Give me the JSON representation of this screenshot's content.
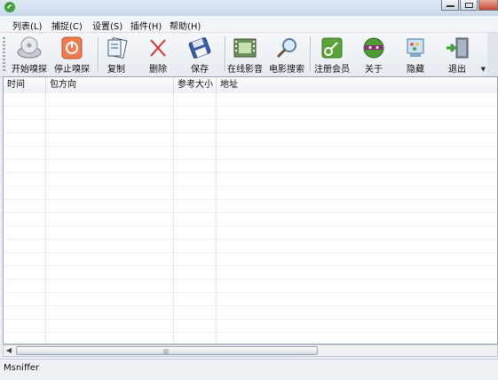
{
  "menu": [
    "列表(L)",
    "捕捉(C)",
    "设置(S)",
    "插件(H)",
    "帮助(H)"
  ],
  "toolbar": {
    "start_sniff": "开始嗅探",
    "stop_sniff": "停止嗅探",
    "copy": "复制",
    "delete": "删除",
    "save": "保存",
    "online_video": "在线影音",
    "movie_search": "电影搜索",
    "register": "注册会员",
    "about": "关于",
    "hide": "隐藏",
    "exit": "退出"
  },
  "columns": [
    "时间",
    "包方向",
    "参考大小",
    "地址"
  ],
  "status": "Msniffer",
  "icons": {
    "start_sniff": "disc-drive-icon",
    "stop_sniff": "power-off-icon",
    "copy": "copy-document-icon",
    "delete": "red-x-icon",
    "save": "floppy-disk-icon",
    "online_video": "film-strip-icon",
    "movie_search": "magnifier-icon",
    "register": "key-icon",
    "about": "ninja-face-icon",
    "hide": "window-paint-icon",
    "exit": "exit-door-icon"
  }
}
